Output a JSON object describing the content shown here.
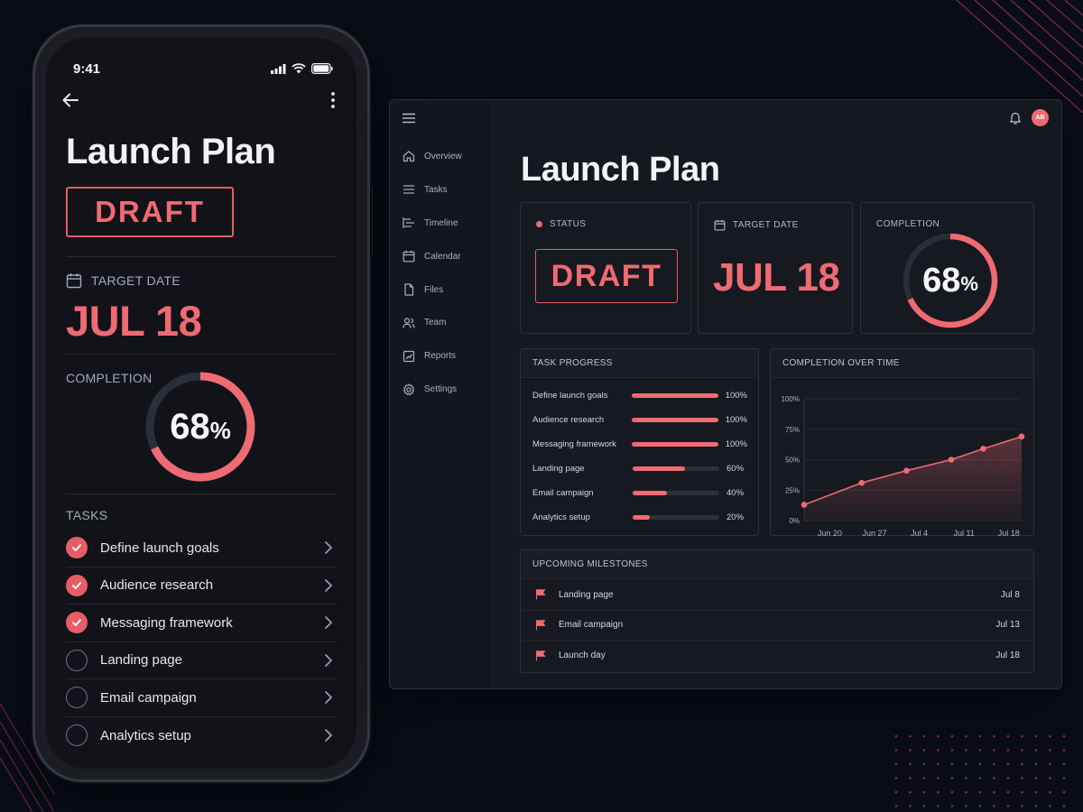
{
  "colors": {
    "accent": "#ef6a72",
    "background": "#0a0d17",
    "panel": "#161920"
  },
  "phone": {
    "status_time": "9:41",
    "title": "Launch Plan",
    "status_badge": "DRAFT",
    "target_date_label": "TARGET DATE",
    "target_date": "JUL 18",
    "completion_label": "COMPLETION",
    "completion_value": "68",
    "completion_unit": "%",
    "completion_fraction": 0.68,
    "tasks_label": "TASKS",
    "tasks": [
      {
        "name": "Define launch goals",
        "done": true
      },
      {
        "name": "Audience research",
        "done": true
      },
      {
        "name": "Messaging framework",
        "done": true
      },
      {
        "name": "Landing page",
        "done": false
      },
      {
        "name": "Email campaign",
        "done": false
      },
      {
        "name": "Analytics setup",
        "done": false
      }
    ]
  },
  "desktop": {
    "avatar_initials": "AB",
    "title": "Launch Plan",
    "nav": [
      {
        "label": "Overview",
        "icon": "home-icon",
        "active": true
      },
      {
        "label": "Tasks",
        "icon": "list-icon",
        "active": false
      },
      {
        "label": "Timeline",
        "icon": "timeline-icon",
        "active": false
      },
      {
        "label": "Calendar",
        "icon": "calendar-icon",
        "active": false
      },
      {
        "label": "Files",
        "icon": "file-icon",
        "active": false
      },
      {
        "label": "Team",
        "icon": "team-icon",
        "active": false
      },
      {
        "label": "Reports",
        "icon": "report-icon",
        "active": false
      },
      {
        "label": "Settings",
        "icon": "gear-icon",
        "active": false
      }
    ],
    "status_card": {
      "label": "STATUS",
      "value": "DRAFT"
    },
    "date_card": {
      "label": "TARGET DATE",
      "value": "JUL 18"
    },
    "completion_card": {
      "label": "COMPLETION",
      "value": "68",
      "unit": "%",
      "fraction": 0.68
    },
    "task_progress": {
      "title": "TASK PROGRESS",
      "rows": [
        {
          "name": "Define launch goals",
          "percent": 100,
          "label": "100%"
        },
        {
          "name": "Audience research",
          "percent": 100,
          "label": "100%"
        },
        {
          "name": "Messaging framework",
          "percent": 100,
          "label": "100%"
        },
        {
          "name": "Landing page",
          "percent": 60,
          "label": "60%"
        },
        {
          "name": "Email campaign",
          "percent": 40,
          "label": "40%"
        },
        {
          "name": "Analytics setup",
          "percent": 20,
          "label": "20%"
        }
      ]
    },
    "completion_chart_title": "COMPLETION OVER TIME",
    "milestones": {
      "title": "UPCOMING MILESTONES",
      "items": [
        {
          "name": "Landing page",
          "date": "Jul 8"
        },
        {
          "name": "Email campaign",
          "date": "Jul 13"
        },
        {
          "name": "Launch day",
          "date": "Jul 18"
        }
      ]
    }
  },
  "chart_data": {
    "type": "area",
    "title": "COMPLETION OVER TIME",
    "x_ticks": [
      "Jun 20",
      "Jun 27",
      "Jul 4",
      "Jul 11",
      "Jul 18"
    ],
    "y_ticks": [
      "0%",
      "25%",
      "50%",
      "75%",
      "100%"
    ],
    "ylim": [
      0,
      100
    ],
    "points": [
      {
        "x": "Jun 16",
        "y": 13
      },
      {
        "x": "Jun 25",
        "y": 31
      },
      {
        "x": "Jul 2",
        "y": 41
      },
      {
        "x": "Jul 9",
        "y": 50
      },
      {
        "x": "Jul 14",
        "y": 59
      },
      {
        "x": "Jul 20",
        "y": 69
      }
    ],
    "grid": true,
    "color": "#ef6a72"
  }
}
